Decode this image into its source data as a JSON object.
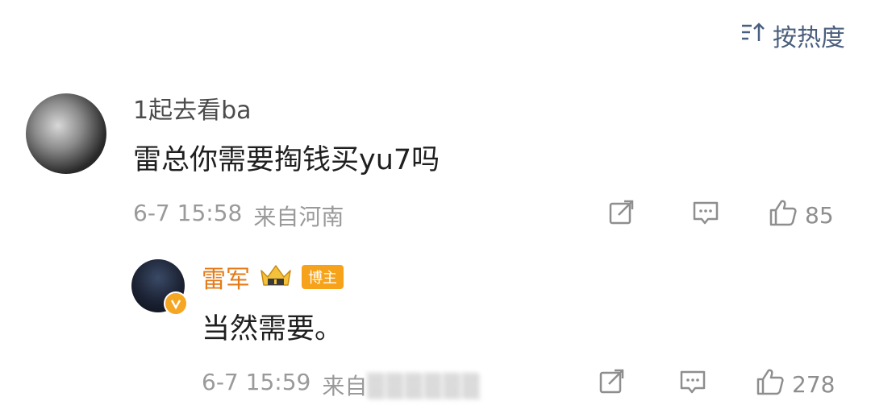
{
  "sort": {
    "label": "按热度",
    "icon": "sort-icon"
  },
  "comment": {
    "username": "1起去看ba",
    "text": "雷总你需要掏钱买yu7吗",
    "date": "6-7 15:58",
    "location": "来自河南",
    "likes": "85",
    "icons": [
      "share-icon",
      "comment-icon",
      "like-icon"
    ]
  },
  "reply": {
    "username": "雷军",
    "tag": "博主",
    "text": "当然需要。",
    "date": "6-7 15:59",
    "location_partial": "来自",
    "likes": "278",
    "icons": [
      "verified-icon",
      "crown-icon",
      "share-icon",
      "comment-icon",
      "like-icon"
    ]
  },
  "colors": {
    "accent_blue": "#4a5f7d",
    "author_orange": "#e47b18",
    "tag_orange": "#f6a21a",
    "meta_gray": "#9a9a9a"
  }
}
